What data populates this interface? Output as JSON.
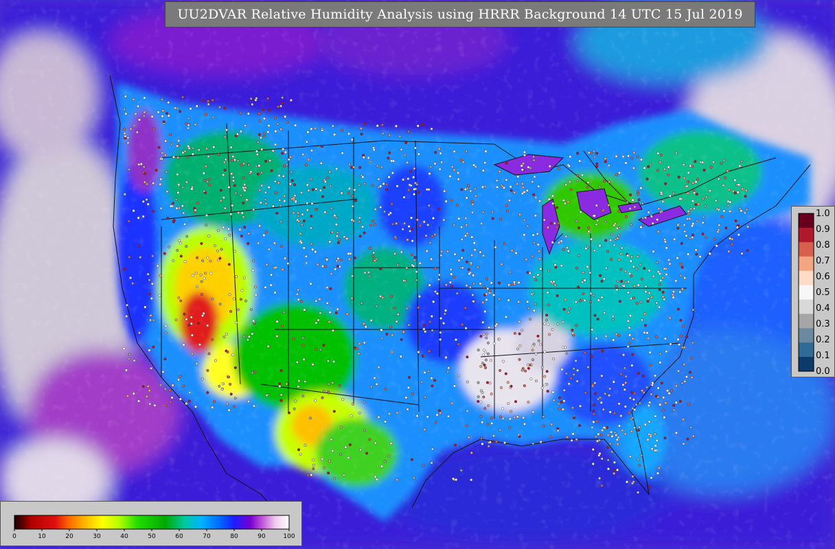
{
  "title": "UU2DVAR Relative Humidity Analysis using HRRR Background 14 UTC 15 Jul 2019",
  "obs_legend": {
    "ticks": [
      "1.0",
      "0.9",
      "0.8",
      "0.7",
      "0.6",
      "0.5",
      "0.4",
      "0.3",
      "0.2",
      "0.1",
      "0.0"
    ],
    "colors": [
      "#67001f",
      "#b2182b",
      "#d6604d",
      "#f4a582",
      "#fddbc7",
      "#f7f7f7",
      "#d9d9d9",
      "#a6a6a6",
      "#6a8aa0",
      "#2f6b96",
      "#0b3a6b"
    ]
  },
  "rh_colorbar": {
    "ticks": [
      "0",
      "10",
      "20",
      "30",
      "40",
      "50",
      "60",
      "70",
      "80",
      "90",
      "100"
    ],
    "stops": [
      {
        "v": 0,
        "c": "#1a0000"
      },
      {
        "v": 3,
        "c": "#5a0000"
      },
      {
        "v": 6,
        "c": "#b00000"
      },
      {
        "v": 15,
        "c": "#e01010"
      },
      {
        "v": 20,
        "c": "#ff6a00"
      },
      {
        "v": 25,
        "c": "#ffb000"
      },
      {
        "v": 32,
        "c": "#ffff00"
      },
      {
        "v": 38,
        "c": "#b6ff00"
      },
      {
        "v": 45,
        "c": "#22dd00"
      },
      {
        "v": 55,
        "c": "#00aa00"
      },
      {
        "v": 62,
        "c": "#00c8a0"
      },
      {
        "v": 68,
        "c": "#00b4ff"
      },
      {
        "v": 75,
        "c": "#0066ff"
      },
      {
        "v": 80,
        "c": "#1d1dff"
      },
      {
        "v": 86,
        "c": "#7a00d0"
      },
      {
        "v": 91,
        "c": "#cc66dd"
      },
      {
        "v": 95,
        "c": "#eeccee"
      },
      {
        "v": 100,
        "c": "#ffffff"
      }
    ]
  },
  "colors": {
    "ocean_bg": "#8a2be2",
    "land_base": "#1e90ff",
    "boundary": "#111111",
    "panel": "#c8c8c8",
    "title_bg": "#7a7a7a"
  }
}
